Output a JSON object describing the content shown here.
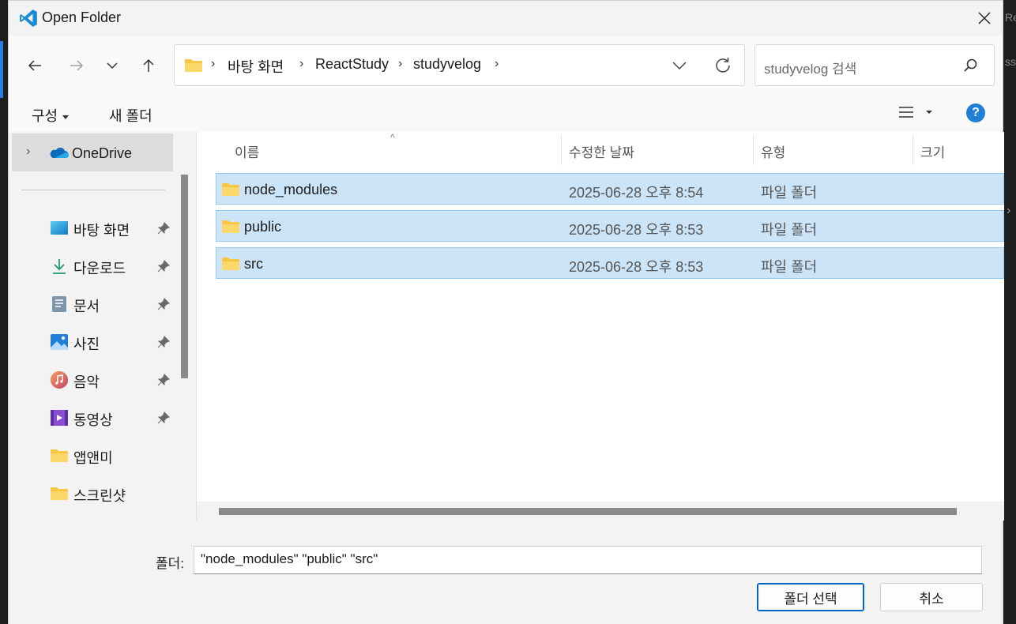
{
  "window": {
    "title": "Open Folder"
  },
  "background": {
    "right_text_1": "Rea",
    "right_text_2": "ss"
  },
  "nav": {
    "back": "back",
    "forward": "forward",
    "recent": "recent",
    "up": "up"
  },
  "breadcrumb": [
    "바탕 화면",
    "ReactStudy",
    "studyvelog"
  ],
  "search": {
    "placeholder": "studyvelog 검색"
  },
  "toolbar": {
    "organize_label": "구성",
    "new_folder_label": "새 폴더",
    "help_label": "?"
  },
  "sidebar": {
    "onedrive": "OneDrive",
    "items": [
      {
        "label": "바탕 화면",
        "icon": "desktop-icon",
        "pinned": true
      },
      {
        "label": "다운로드",
        "icon": "download-icon",
        "pinned": true
      },
      {
        "label": "문서",
        "icon": "document-icon",
        "pinned": true
      },
      {
        "label": "사진",
        "icon": "picture-icon",
        "pinned": true
      },
      {
        "label": "음악",
        "icon": "music-icon",
        "pinned": true
      },
      {
        "label": "동영상",
        "icon": "video-icon",
        "pinned": true
      },
      {
        "label": "앱앤미",
        "icon": "folder-icon",
        "pinned": false
      },
      {
        "label": "스크린샷",
        "icon": "folder-icon",
        "pinned": false
      }
    ]
  },
  "columns": {
    "name": "이름",
    "date": "수정한 날짜",
    "type": "유형",
    "size": "크기"
  },
  "files": [
    {
      "name": "node_modules",
      "date": "2025-06-28 오후 8:54",
      "type": "파일 폴더",
      "selected": true
    },
    {
      "name": "public",
      "date": "2025-06-28 오후 8:53",
      "type": "파일 폴더",
      "selected": true
    },
    {
      "name": "src",
      "date": "2025-06-28 오후 8:53",
      "type": "파일 폴더",
      "selected": true
    }
  ],
  "footer": {
    "folder_label": "폴더:",
    "folder_value": "\"node_modules\" \"public\" \"src\"",
    "select_button": "폴더 선택",
    "cancel_button": "취소"
  },
  "colors": {
    "selection": "#cce4f7",
    "accent": "#0067c0",
    "folder": "#f8c647"
  }
}
